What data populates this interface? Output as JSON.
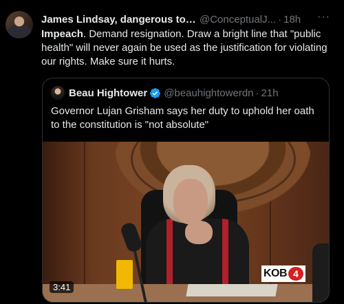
{
  "tweet": {
    "author_name": "James Lindsay, dangerous to ...",
    "handle": "@ConceptualJ...",
    "separator": "·",
    "time": "18h",
    "more": "···",
    "body_bold": "Impeach",
    "body_rest": ". Demand resignation. Draw a bright line that \"public health\" will never again be used as the justification for violating our rights. Make sure it hurts."
  },
  "quote": {
    "author_name": "Beau Hightower",
    "verified": true,
    "handle": "@beauhightowerdn",
    "separator": "·",
    "time": "21h",
    "text": "Governor Lujan Grisham says her duty to uphold her oath to the constitution is \"not absolute\"",
    "video": {
      "duration": "3:41",
      "logo_text": "KOB",
      "logo_number": "4"
    }
  },
  "icons": {
    "verified": "verified-badge-icon",
    "more": "more-icon"
  },
  "colors": {
    "background": "#000000",
    "text": "#e7e9ea",
    "secondary": "#71767b",
    "verified": "#1d9bf0",
    "border": "#2f3336"
  }
}
